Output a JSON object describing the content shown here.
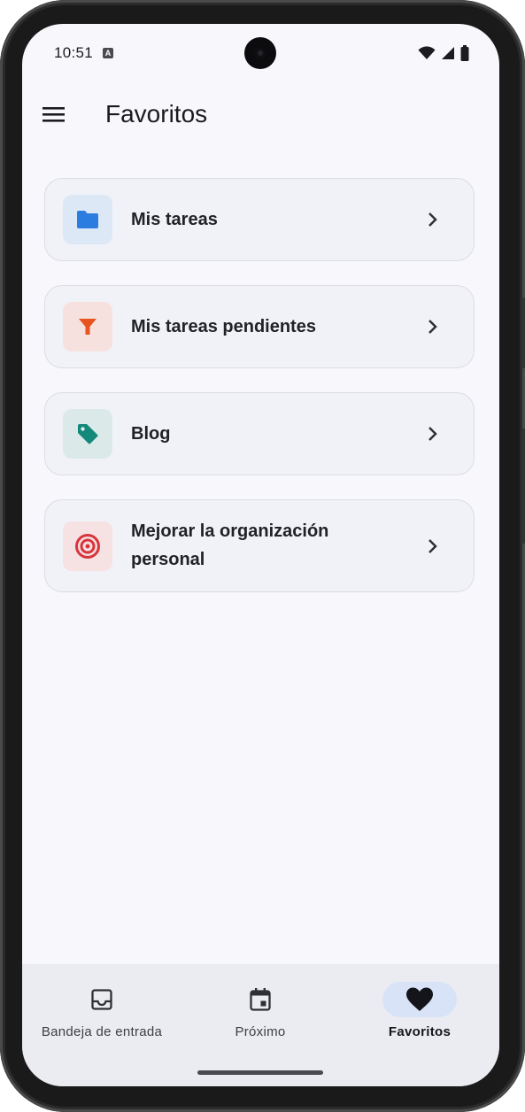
{
  "status_bar": {
    "time": "10:51",
    "notification_icon": "A",
    "icons": [
      "wifi-icon",
      "signal-icon",
      "battery-icon"
    ]
  },
  "app_bar": {
    "title": "Favoritos",
    "menu_icon": "menu-icon"
  },
  "favorites": [
    {
      "label": "Mis tareas",
      "icon": "folder-icon",
      "icon_color": "#2b7de0",
      "icon_bg": "#dde8f7"
    },
    {
      "label": "Mis tareas pendientes",
      "icon": "filter-icon",
      "icon_color": "#e8541f",
      "icon_bg": "#f6e1df"
    },
    {
      "label": "Blog",
      "icon": "tag-icon",
      "icon_color": "#14887a",
      "icon_bg": "#dbeae9"
    },
    {
      "label": "Mejorar la organización personal",
      "icon": "target-icon",
      "icon_color": "#d7373c",
      "icon_bg": "#f6e1e3"
    }
  ],
  "bottom_nav": {
    "items": [
      {
        "label": "Bandeja de entrada",
        "icon": "inbox-icon",
        "active": false
      },
      {
        "label": "Próximo",
        "icon": "calendar-icon",
        "active": false
      },
      {
        "label": "Favoritos",
        "icon": "heart-icon",
        "active": true
      }
    ],
    "active_pill_color": "#d9e3f7"
  }
}
